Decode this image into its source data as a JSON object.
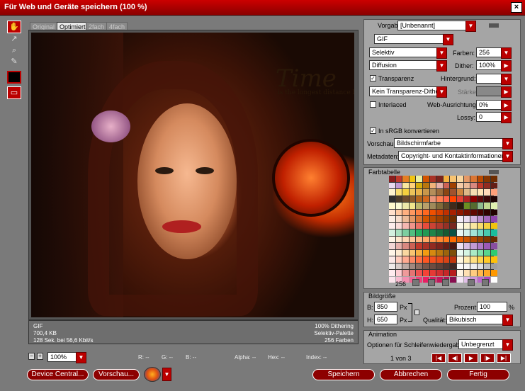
{
  "window": {
    "title": "Für Web und Geräte speichern (100 %)",
    "close_glyph": "×"
  },
  "tools": [
    {
      "name": "hand-tool-icon",
      "glyph": "✋",
      "active": true
    },
    {
      "name": "slice-select-tool-icon",
      "glyph": "↗",
      "active": false
    },
    {
      "name": "zoom-tool-icon",
      "glyph": "⌕",
      "active": false
    },
    {
      "name": "eyedropper-tool-icon",
      "glyph": "✎",
      "active": false
    },
    {
      "name": "eyedropper-color-icon",
      "glyph": "■",
      "active": true
    },
    {
      "name": "toggle-slices-icon",
      "glyph": "▭",
      "active": true
    }
  ],
  "tabs": [
    "Original",
    "Optimiert",
    "2fach",
    "4fach"
  ],
  "artwork": {
    "headline": "Time",
    "tagline": "is the longest distance be"
  },
  "preview_info": {
    "format": "GIF",
    "size": "700,4 KB",
    "time": "128 Sek. bei 56,6 Kbit/s",
    "dither": "100% Dithering",
    "palette": "Selektiv-Palette",
    "colors": "256 Farben"
  },
  "bottom": {
    "zoom_value": "100%",
    "r_label": "R: --",
    "g_label": "G: --",
    "b_label": "B: --",
    "alpha_label": "Alpha: --",
    "hex_label": "Hex: --",
    "index_label": "Index: --",
    "device_central": "Device Central...",
    "preview_button": "Vorschau...",
    "save": "Speichern",
    "cancel": "Abbrechen",
    "done": "Fertig"
  },
  "settings": {
    "vorgabe_label": "Vorgabe:",
    "vorgabe_value": "[Unbenannt]",
    "format_value": "GIF",
    "palette_value": "Selektiv",
    "farben_label": "Farben:",
    "farben_value": "256",
    "dither_algo": "Diffusion",
    "dither_label": "Dither:",
    "dither_value": "100%",
    "transparenz_label": "Transparenz",
    "hintergrund_label": "Hintergrund:",
    "transp_dither": "Kein Transparenz-Dither",
    "staerke_label": "Stärke:",
    "interlaced_label": "Interlaced",
    "web_label": "Web-Ausrichtung:",
    "web_value": "0%",
    "lossy_label": "Lossy:",
    "lossy_value": "0",
    "srgb_label": "In sRGB konvertieren",
    "vorschau_label": "Vorschau:",
    "vorschau_value": "Bildschirmfarbe",
    "metadaten_label": "Metadaten:",
    "metadaten_value": "Copyright- und Kontaktinformationen"
  },
  "color_table": {
    "title": "Farbtabelle",
    "count": "256",
    "swatches": [
      "#8a1e1e",
      "#c0392b",
      "#e67e22",
      "#f1c40f",
      "#ecf0a0",
      "#d35400",
      "#a93226",
      "#7b241c",
      "#f5b041",
      "#f8c471",
      "#fad7a0",
      "#e59866",
      "#dc7633",
      "#ba4a00",
      "#873600",
      "#6e2c00",
      "#e8daef",
      "#c39bd3",
      "#f9e79f",
      "#ffd27a",
      "#d4ac0d",
      "#b9770e",
      "#f0b27a",
      "#e6b0aa",
      "#cd6155",
      "#a04000",
      "#f5cba7",
      "#edbb99",
      "#d98880",
      "#c0392b",
      "#922b21",
      "#641e16",
      "#fcf3cf",
      "#f7dc6f",
      "#f4d03f",
      "#ecc35a",
      "#e9b44c",
      "#c9974a",
      "#b58e5a",
      "#9c6b3a",
      "#8b4513",
      "#a0522d",
      "#cd853f",
      "#deb887",
      "#f5deb3",
      "#ffe4b5",
      "#ffdab9",
      "#ffa07a",
      "#2e2e2e",
      "#4a3b2a",
      "#6d4c2f",
      "#8c5a2b",
      "#b5651d",
      "#d2691e",
      "#e9967a",
      "#ff7f50",
      "#ff6347",
      "#ff4500",
      "#e34234",
      "#b22222",
      "#8b0000",
      "#5c0a0a",
      "#3b0707",
      "#1f0303",
      "#fffacd",
      "#fafad2",
      "#eee8aa",
      "#f0e68c",
      "#bdb76b",
      "#b8a06a",
      "#9f8a5a",
      "#7f6a3a",
      "#5f4a2a",
      "#3f2a1a",
      "#2a1a0a",
      "#6b8e23",
      "#556b2f",
      "#8fbc8f",
      "#c0d890",
      "#e0f0b0",
      "#ffe0cc",
      "#ffc8a0",
      "#ffb080",
      "#ff9860",
      "#ff8040",
      "#ff6820",
      "#f05000",
      "#d84000",
      "#c03000",
      "#a82000",
      "#901800",
      "#781000",
      "#600800",
      "#480400",
      "#300200",
      "#200100",
      "#fbeee6",
      "#f6ddcc",
      "#edbb99",
      "#e59866",
      "#dc7633",
      "#d35400",
      "#ba4a00",
      "#a04000",
      "#873600",
      "#6e2c00",
      "#f4ecf7",
      "#e8daef",
      "#d2b4de",
      "#bb8fce",
      "#a569bd",
      "#8e44ad",
      "#fdedec",
      "#fadbd8",
      "#f5b7b1",
      "#f1948a",
      "#ec7063",
      "#e74c3c",
      "#cb4335",
      "#b03a2e",
      "#943126",
      "#78281f",
      "#fef9e7",
      "#fcf3cf",
      "#f9e79f",
      "#f7dc6f",
      "#f4d03f",
      "#f1c40f",
      "#d4efdf",
      "#a9dfbf",
      "#7dcea0",
      "#52be80",
      "#27ae60",
      "#229954",
      "#1e8449",
      "#196f3d",
      "#145a32",
      "#0b5345",
      "#e8f8f5",
      "#d1f2eb",
      "#a3e4d7",
      "#76d7c4",
      "#48c9b0",
      "#1abc9c",
      "#fff5e6",
      "#ffe6cc",
      "#ffd6b3",
      "#ffc799",
      "#ffb880",
      "#ffa866",
      "#ff994d",
      "#ff8933",
      "#ff7a1a",
      "#ff6a00",
      "#e65f00",
      "#cc5500",
      "#b34a00",
      "#994000",
      "#803500",
      "#662b00",
      "#f2d7d5",
      "#e6b0aa",
      "#d98880",
      "#cd6155",
      "#c0392b",
      "#a93226",
      "#922b21",
      "#7b241c",
      "#641e16",
      "#4a1511",
      "#ebdef0",
      "#d7bde2",
      "#c39bd3",
      "#af7ac5",
      "#9b59b6",
      "#884ea0",
      "#fef5e7",
      "#fdebd0",
      "#fad7a0",
      "#f8c471",
      "#f5b041",
      "#f39c12",
      "#d68910",
      "#b9770e",
      "#9c640c",
      "#7e5109",
      "#eafaf1",
      "#d5f5e3",
      "#abebc6",
      "#82e0aa",
      "#58d68d",
      "#2ecc71",
      "#fbe9e7",
      "#ffccbc",
      "#ffab91",
      "#ff8a65",
      "#ff7043",
      "#ff5722",
      "#f4511e",
      "#e64a19",
      "#d84315",
      "#bf360c",
      "#fff8e1",
      "#ffecb3",
      "#ffe082",
      "#ffd54f",
      "#ffca28",
      "#ffc107",
      "#efebe9",
      "#d7ccc8",
      "#bcaaa4",
      "#a1887f",
      "#8d6e63",
      "#795548",
      "#6d4c41",
      "#5d4037",
      "#4e342e",
      "#3e2723",
      "#fafafa",
      "#f5f5f5",
      "#eeeeee",
      "#e0e0e0",
      "#bdbdbd",
      "#9e9e9e",
      "#ffebee",
      "#ffcdd2",
      "#ef9a9a",
      "#e57373",
      "#ef5350",
      "#f44336",
      "#e53935",
      "#d32f2f",
      "#c62828",
      "#b71c1c",
      "#fff3e0",
      "#ffe0b2",
      "#ffcc80",
      "#ffb74d",
      "#ffa726",
      "#ff9800",
      "#fce4ec",
      "#f8bbd0",
      "#f48fb1",
      "#f06292",
      "#ec407a",
      "#e91e63",
      "#d81b60",
      "#c2185b",
      "#ad1457",
      "#880e4f",
      "#f3e5f5",
      "#e1bee7",
      "#ce93d8",
      "#ba68c8",
      "#ab47bc",
      "#ffffff"
    ]
  },
  "image_size": {
    "title": "Bildgröße",
    "b_label": "B:",
    "b_value": "850",
    "h_label": "H:",
    "h_value": "650",
    "px": "Px",
    "prozent_label": "Prozent:",
    "prozent_value": "100",
    "prozent_unit": "%",
    "qualitaet_label": "Qualität:",
    "qualitaet_value": "Bikubisch"
  },
  "animation": {
    "title": "Animation",
    "loop_label": "Optionen für Schleifenwiedergabe:",
    "loop_value": "Unbegrenzt",
    "frame_counter": "1 von 3"
  }
}
